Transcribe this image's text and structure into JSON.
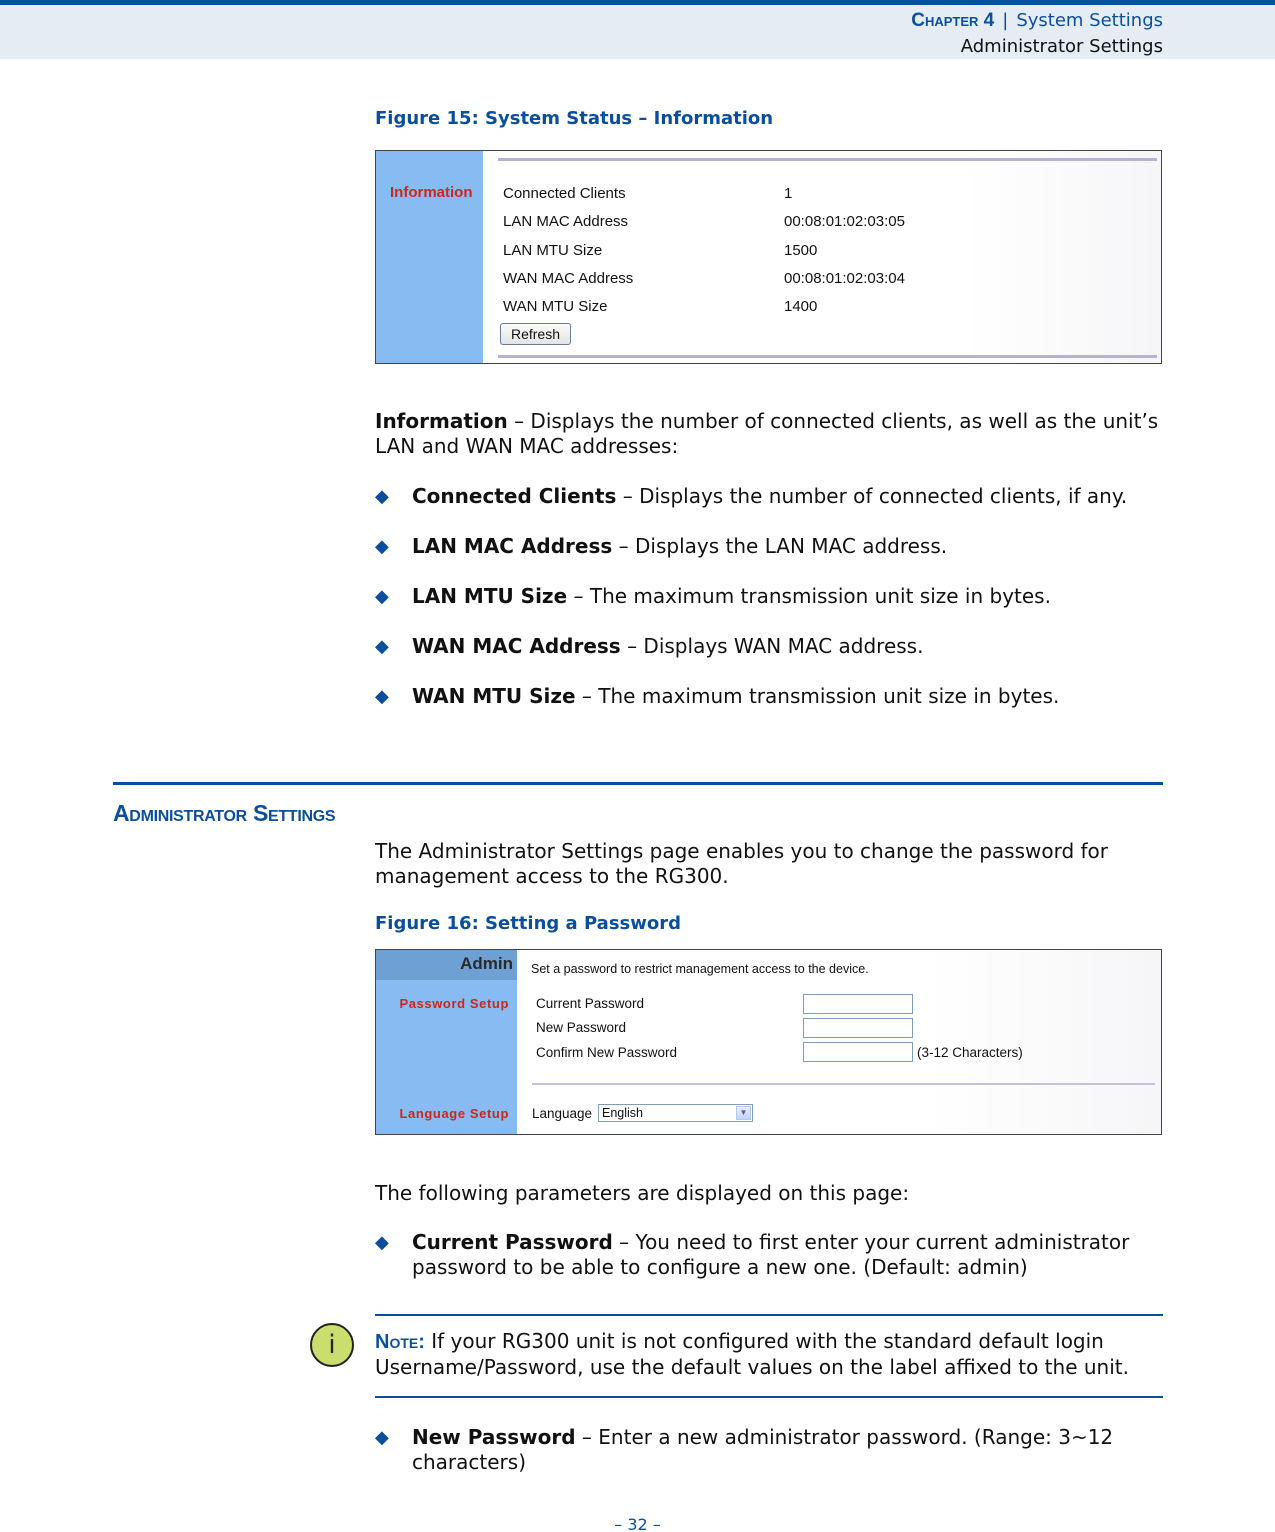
{
  "header": {
    "chapter_label": "Chapter 4",
    "separator": "|",
    "chapter_title": "System Settings",
    "section_title": "Administrator Settings"
  },
  "figure15": {
    "caption": "Figure 15:  System Status – Information",
    "sidebar_label": "Information",
    "rows": [
      {
        "label": "Connected Clients",
        "value": "1"
      },
      {
        "label": "LAN MAC Address",
        "value": "00:08:01:02:03:05"
      },
      {
        "label": "LAN MTU Size",
        "value": "1500"
      },
      {
        "label": "WAN MAC Address",
        "value": "00:08:01:02:03:04"
      },
      {
        "label": "WAN MTU Size",
        "value": "1400"
      }
    ],
    "refresh_label": "Refresh"
  },
  "info_para": {
    "term": "Information",
    "text": " – Displays the number of connected clients, as well as the unit’s LAN and WAN MAC addresses:"
  },
  "info_bullets": [
    {
      "term": "Connected Clients",
      "text": " – Displays the number of connected clients, if any."
    },
    {
      "term": "LAN MAC Address",
      "text": " – Displays the LAN MAC address."
    },
    {
      "term": "LAN MTU Size",
      "text": " – The maximum transmission unit size in bytes."
    },
    {
      "term": "WAN MAC Address",
      "text": " – Displays WAN MAC address."
    },
    {
      "term": "WAN MTU Size",
      "text": " – The maximum transmission unit size in bytes."
    }
  ],
  "admin_section": {
    "title": "Administrator Settings",
    "intro": "The Administrator Settings page enables you to change the password for management access to the RG300."
  },
  "figure16": {
    "caption": "Figure 16:  Setting a Password",
    "sidebar_header": "Admin",
    "sidebar_password": "Password Setup",
    "sidebar_language": "Language Setup",
    "intro": "Set a password to restrict management access to the device.",
    "fields": [
      {
        "label": "Current Password",
        "value": ""
      },
      {
        "label": "New Password",
        "value": ""
      },
      {
        "label": "Confirm New Password",
        "value": ""
      }
    ],
    "hint": "(3-12 Characters)",
    "language_label": "Language",
    "language_value": "English"
  },
  "params_intro": "The following parameters are displayed on this page:",
  "current_password_bullet": {
    "term": "Current Password",
    "text": " – You need to first enter your current administrator password to be able to configure a new one. (Default: admin)"
  },
  "note": {
    "label": "Note:",
    "text": " If your RG300 unit is not configured with the standard default login Username/Password, use the default values on the label affixed to the unit."
  },
  "new_password_bullet": {
    "term": "New Password",
    "text": " – Enter a new administrator password. (Range: 3~12 characters)"
  },
  "page_number": "–  32  –",
  "colors": {
    "brand_blue": "#0b4f9c",
    "sidebar_blue": "#88bbf1",
    "sidebar_red": "#c8281e",
    "note_icon": "#c9de6c"
  }
}
